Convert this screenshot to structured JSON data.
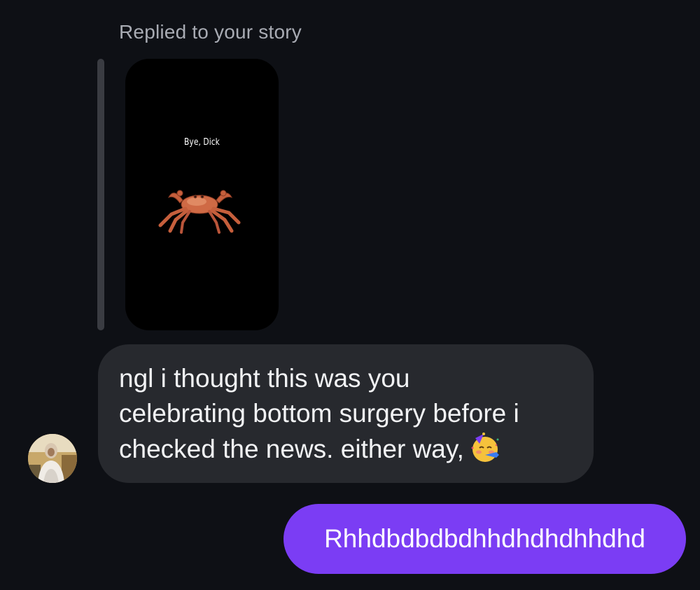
{
  "thread": {
    "reply_label": "Replied to your story",
    "story": {
      "caption": "Bye, Dick"
    },
    "incoming_message": {
      "lines": [
        "ngl i thought this was you",
        "celebrating bottom surgery before i",
        "checked the news. either way,"
      ],
      "emoji": "partying-face"
    },
    "outgoing_message": {
      "text": "Rhhdbdbdbdhhdhdhdhhdhd"
    }
  },
  "colors": {
    "background": "#0e1015",
    "incoming_bubble": "#27292e",
    "outgoing_bubble": "#7b3df4",
    "muted_text": "#a8abb3"
  }
}
